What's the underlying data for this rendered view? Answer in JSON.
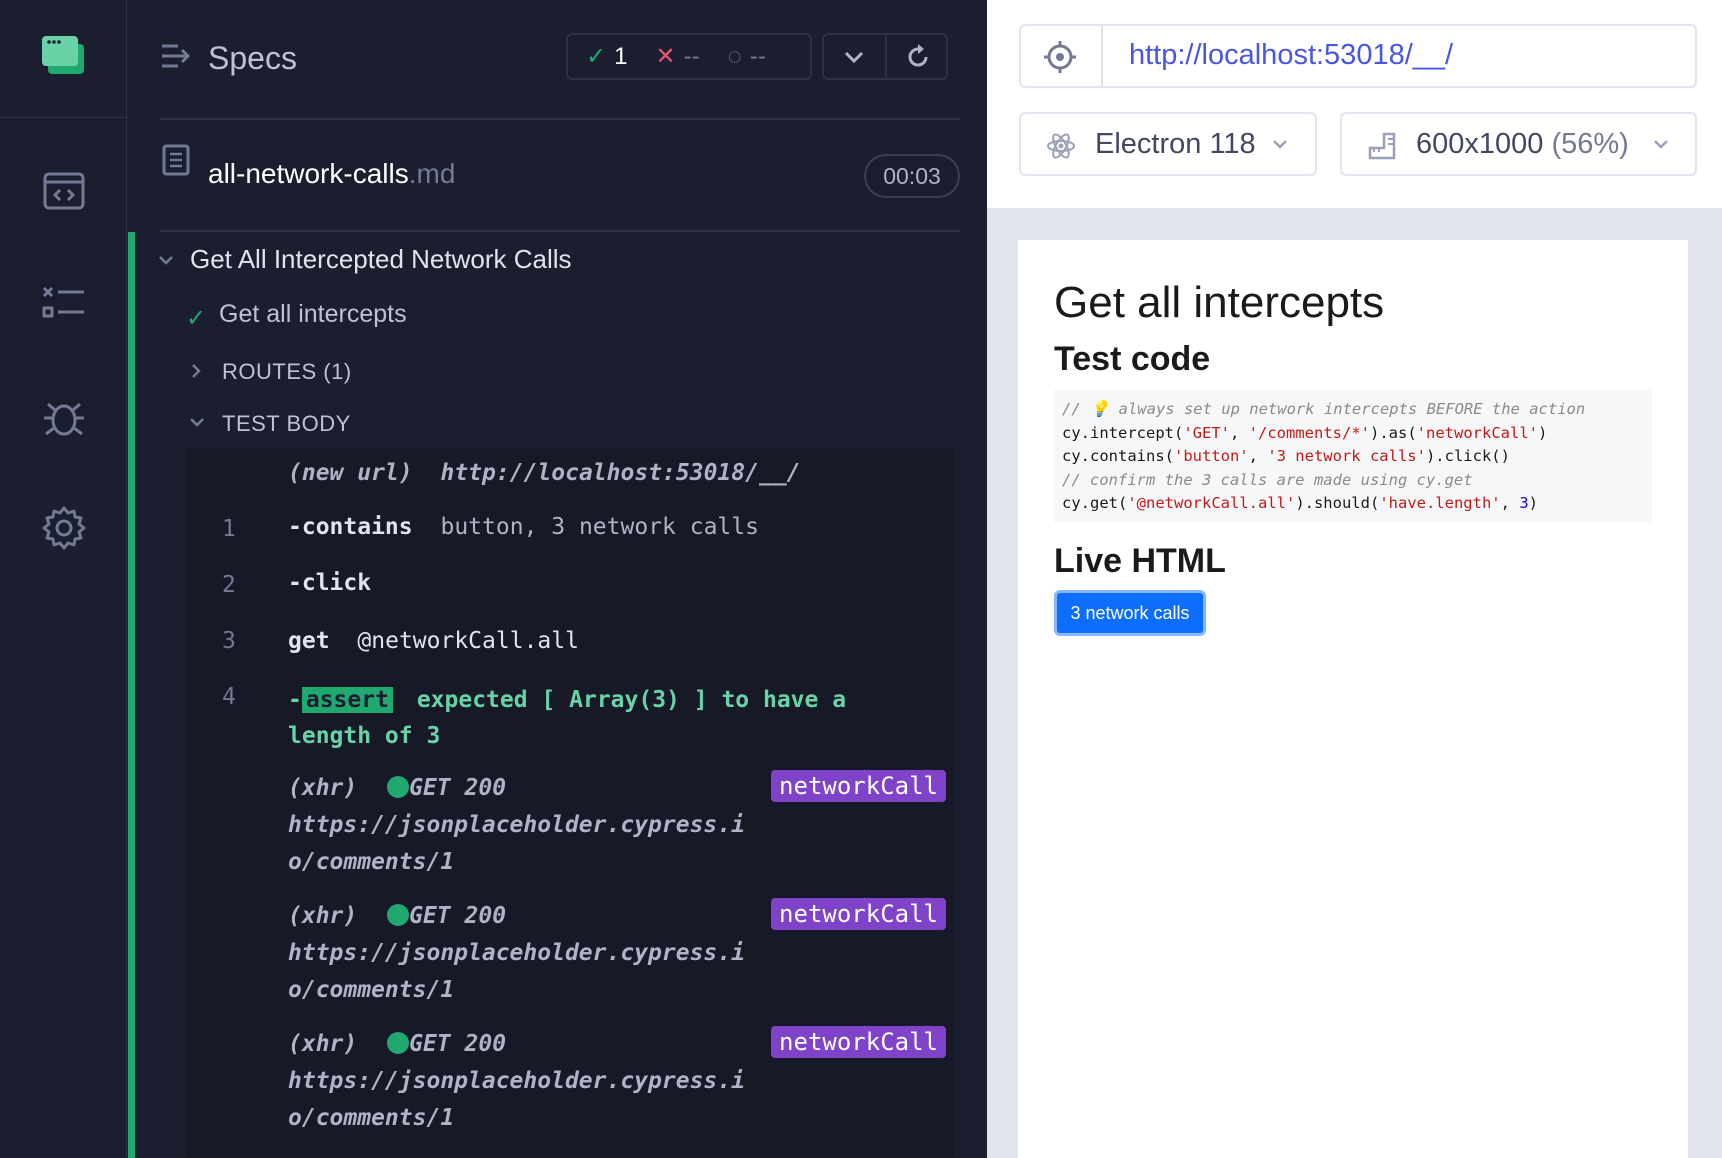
{
  "reporter": {
    "header_title": "Specs",
    "stats": {
      "passed": "1",
      "failed": "--",
      "pending": "--"
    },
    "spec": {
      "name": "all-network-calls",
      "ext": ".md",
      "duration": "00:03"
    },
    "suite_title": "Get All Intercepted Network Calls",
    "test_title": "Get all intercepts",
    "routes_label": "ROUTES (1)",
    "body_label": "TEST BODY",
    "commands": {
      "new_url_label": "(new url)",
      "new_url_value": "http://localhost:53018/__/",
      "c1_num": "1",
      "c1_name": "-contains",
      "c1_msg": "button, 3 network calls",
      "c2_num": "2",
      "c2_name": "-click",
      "c3_num": "3",
      "c3_name": "get",
      "c3_msg": "@networkCall.all",
      "c4_num": "4",
      "c4_dash": "-",
      "c4_badge": "assert",
      "c4_msg_line1": "expected  [ Array(3) ]  to have a",
      "c4_msg_line2": "length of  3",
      "xhr": [
        {
          "type": "(xhr)",
          "status": "GET 200",
          "url_line1": "https://jsonplaceholder.cypress.i",
          "url_line2": "o/comments/1",
          "alias": "networkCall"
        },
        {
          "type": "(xhr)",
          "status": "GET 200",
          "url_line1": "https://jsonplaceholder.cypress.i",
          "url_line2": "o/comments/1",
          "alias": "networkCall"
        },
        {
          "type": "(xhr)",
          "status": "GET 200",
          "url_line1": "https://jsonplaceholder.cypress.i",
          "url_line2": "o/comments/1",
          "alias": "networkCall"
        }
      ]
    }
  },
  "aut": {
    "url": "http://localhost:53018/__/",
    "browser": "Electron 118",
    "viewport": "600x1000",
    "viewport_scale": "(56%)",
    "page": {
      "h1": "Get all intercepts",
      "h2_code": "Test code",
      "code": {
        "l1_comment": "// 💡 always set up network intercepts BEFORE the action",
        "l2_a": "cy.intercept(",
        "l2_s1": "'GET'",
        "l2_b": ", ",
        "l2_s2": "'/comments/*'",
        "l2_c": ").as(",
        "l2_s3": "'networkCall'",
        "l2_d": ")",
        "l3_a": "cy.contains(",
        "l3_s1": "'button'",
        "l3_b": ", ",
        "l3_s2": "'3 network calls'",
        "l3_c": ").click()",
        "l4_comment": "// confirm the 3 calls are made using cy.get",
        "l5_a": "cy.get(",
        "l5_s1": "'@networkCall.all'",
        "l5_b": ").should(",
        "l5_s2": "'have.length'",
        "l5_c": ", ",
        "l5_n": "3",
        "l5_d": ")"
      },
      "h2_live": "Live HTML",
      "button": "3 network calls"
    }
  },
  "colors": {
    "pass": "#1fa971",
    "fail": "#e45770",
    "alias": "#7f43c9",
    "link": "#4956e3",
    "app_button": "#0d6efd"
  }
}
